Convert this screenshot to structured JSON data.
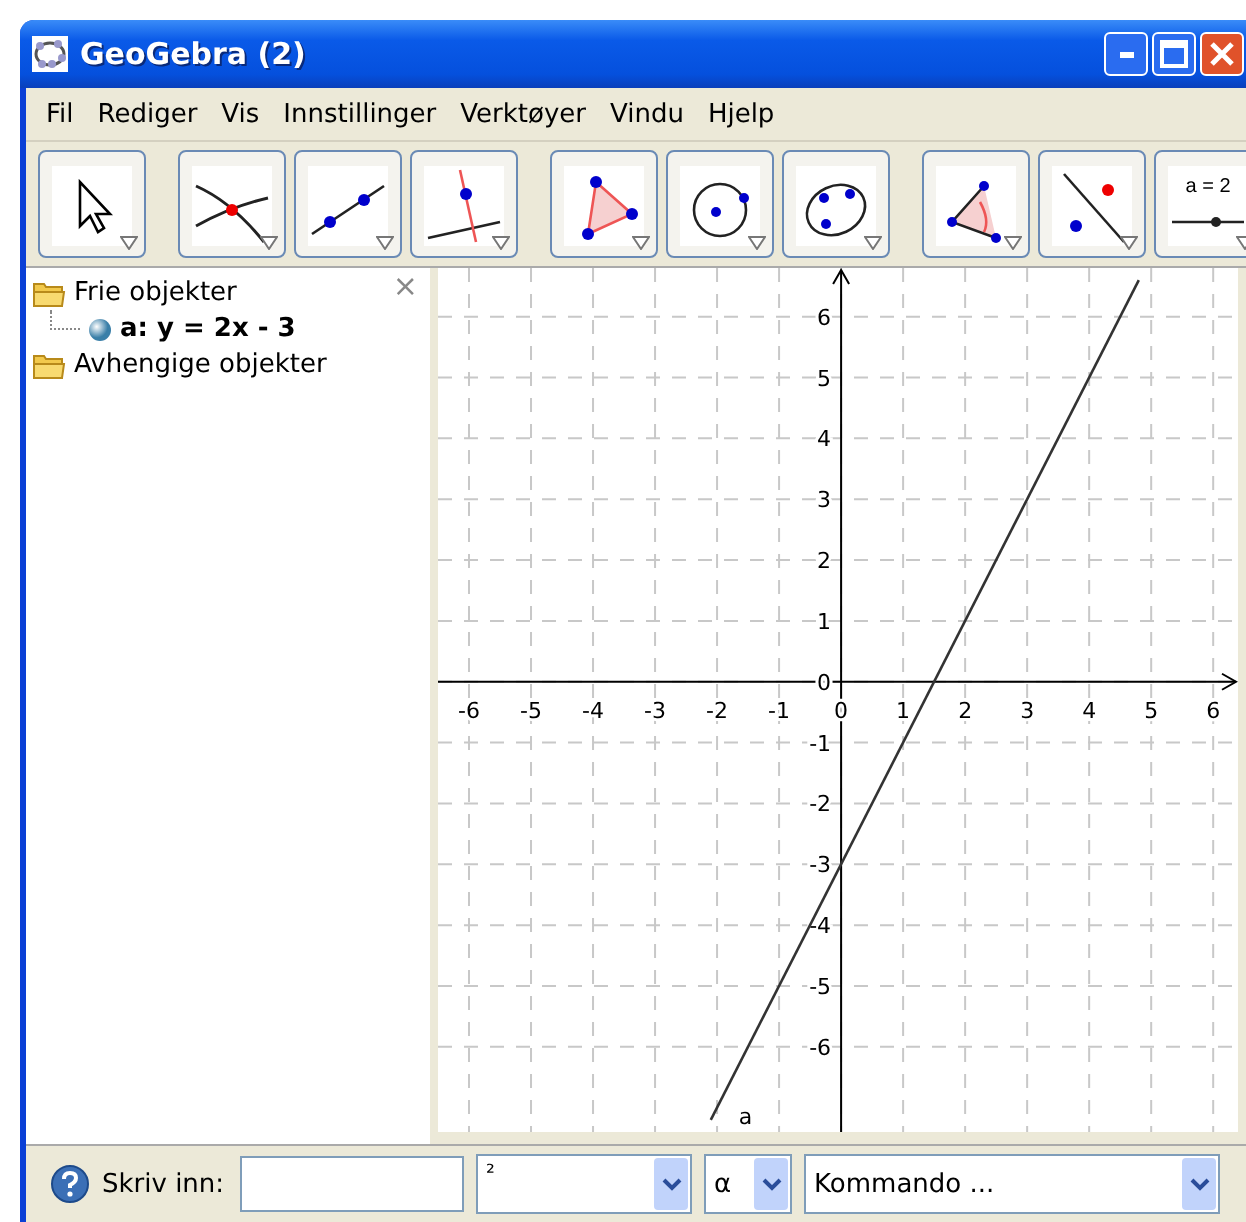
{
  "window": {
    "title": "GeoGebra (2)"
  },
  "menu": [
    "Fil",
    "Rediger",
    "Vis",
    "Innstillinger",
    "Verktøyer",
    "Vindu",
    "Hjelp"
  ],
  "toolbar": [
    {
      "tools": [
        {
          "kind": "move"
        }
      ]
    },
    {
      "tools": [
        {
          "kind": "intersect"
        },
        {
          "kind": "line"
        },
        {
          "kind": "perpendicular"
        }
      ]
    },
    {
      "tools": [
        {
          "kind": "polygon"
        },
        {
          "kind": "circle"
        },
        {
          "kind": "conic"
        }
      ]
    },
    {
      "tools": [
        {
          "kind": "angle"
        },
        {
          "kind": "reflect"
        },
        {
          "kind": "slider",
          "text": "a = 2"
        }
      ]
    }
  ],
  "algebra": {
    "close": "×",
    "folders": [
      {
        "label": "Frie objekter",
        "children": [
          {
            "label": "a: y = 2x - 3"
          }
        ]
      },
      {
        "label": "Avhengige objekter"
      }
    ]
  },
  "graphics": {
    "chart_data": {
      "type": "line",
      "grid": true,
      "x": [
        -2.1,
        4.8
      ],
      "series": [
        {
          "name": "a",
          "color": "#333333",
          "values": [
            -7.2,
            6.6
          ]
        }
      ],
      "xlim": [
        -6.5,
        6.4
      ],
      "ylim": [
        -7.4,
        6.8
      ],
      "xticks": [
        -6,
        -5,
        -4,
        -3,
        -2,
        -1,
        0,
        1,
        2,
        3,
        4,
        5,
        6
      ],
      "yticks": [
        -6,
        -5,
        -4,
        -3,
        -2,
        -1,
        0,
        1,
        2,
        3,
        4,
        5,
        6
      ]
    }
  },
  "input_bar": {
    "label": "Skriv inn:",
    "symbols": "²",
    "greek": "α",
    "command": "Kommando ..."
  }
}
